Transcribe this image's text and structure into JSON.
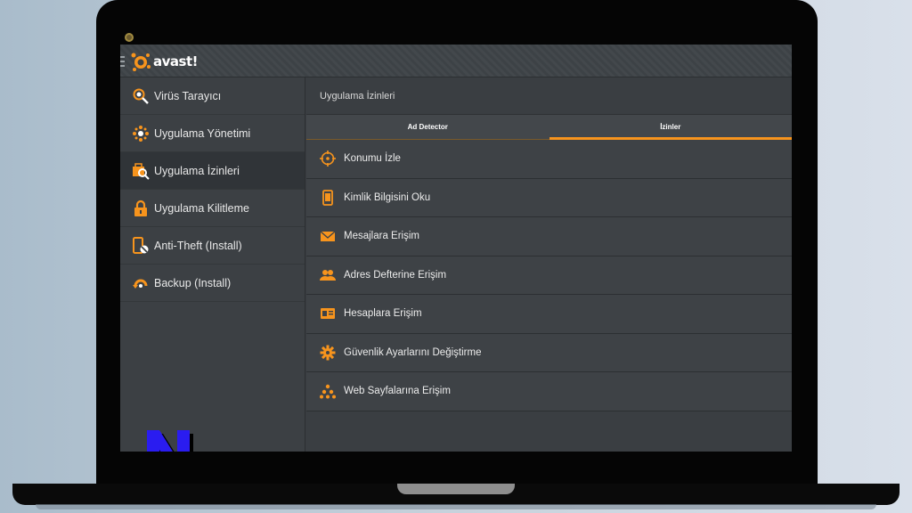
{
  "app": {
    "logo_text": "avast!"
  },
  "sidebar": {
    "items": [
      {
        "label": "Virüs Tarayıcı",
        "icon": "virus-scanner-icon"
      },
      {
        "label": "Uygulama Yönetimi",
        "icon": "app-management-icon"
      },
      {
        "label": "Uygulama İzinleri",
        "icon": "app-permissions-icon",
        "active": true
      },
      {
        "label": "Uygulama Kilitleme",
        "icon": "lock-icon"
      },
      {
        "label": "Anti-Theft (Install)",
        "icon": "anti-theft-icon"
      },
      {
        "label": "Backup (Install)",
        "icon": "backup-icon"
      }
    ]
  },
  "main": {
    "title": "Uygulama İzinleri",
    "tabs": [
      {
        "label": "Ad Detector"
      },
      {
        "label": "İzinler",
        "active": true
      }
    ],
    "permissions": [
      {
        "label": "Konumu İzle",
        "icon": "location-icon"
      },
      {
        "label": "Kimlik Bilgisini Oku",
        "icon": "phone-icon"
      },
      {
        "label": "Mesajlara Erişim",
        "icon": "envelope-icon"
      },
      {
        "label": "Adres Defterine Erişim",
        "icon": "contacts-icon"
      },
      {
        "label": "Hesaplara Erişim",
        "icon": "id-card-icon"
      },
      {
        "label": "Güvenlik Ayarlarını Değiştirme",
        "icon": "gear-icon"
      },
      {
        "label": "Web Sayfalarına Erişim",
        "icon": "network-icon"
      }
    ]
  },
  "colors": {
    "accent": "#f7941d",
    "background": "#3a3e42",
    "sidebar": "#3c4044"
  }
}
